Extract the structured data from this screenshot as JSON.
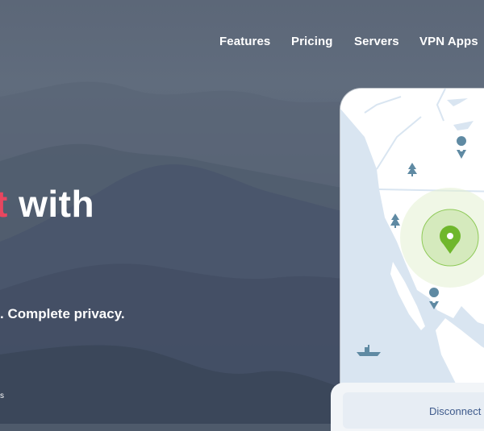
{
  "nav": {
    "features": "Features",
    "pricing": "Pricing",
    "servers": "Servers",
    "vpn_apps": "VPN Apps"
  },
  "hero": {
    "headline_accent": "t",
    "headline": " with",
    "subline": ". Complete privacy.",
    "tiny": "s"
  },
  "app": {
    "disconnect_label": "Disconnect"
  },
  "colors": {
    "accent": "#e8465f",
    "map_land": "#ffffff",
    "map_water": "#d9e5f1",
    "pin_active": "#6fb72c",
    "pin_inactive": "#5f8aa3"
  }
}
